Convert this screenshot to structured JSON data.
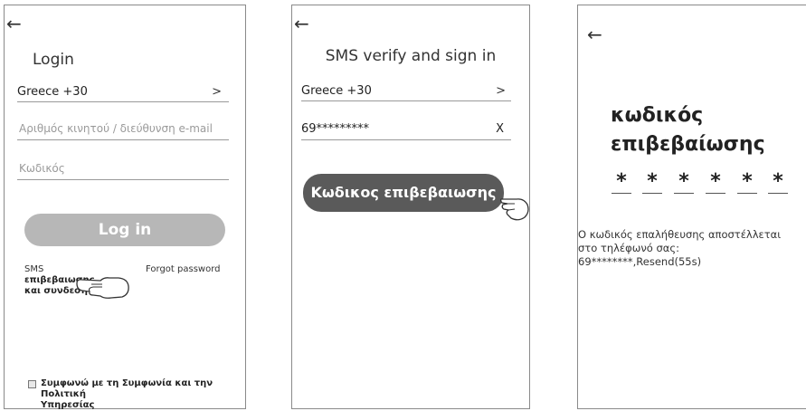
{
  "screen1": {
    "back": "←",
    "title": "Login",
    "country": "Greece +30",
    "chevron": ">",
    "phone_placeholder": "Αριθμός κινητού / διεύθυνση e-mail",
    "password_placeholder": "Κωδικός",
    "login_button": "Log in",
    "sms_line1": "SMS",
    "sms_line2": "επιβεβαιωσης",
    "sms_line3": "και συνδεση",
    "forgot": "Forgot password",
    "agree_line1": "Συμφωνώ με τη Συμφωνία και την Πολιτική",
    "agree_line2": "Υπηρεσίας"
  },
  "screen2": {
    "back": "←",
    "title": "SMS verify and sign in",
    "country": "Greece +30",
    "chevron": ">",
    "phone": "69*********",
    "clear": "X",
    "code_button": "Κωδικος επιβεβαιωσης"
  },
  "screen3": {
    "back": "←",
    "title_line1": "κωδικός",
    "title_line2": "επιβεβαίωσης",
    "digits": [
      "*",
      "*",
      "*",
      "*",
      "*",
      "*"
    ],
    "info_line1": "Ο κωδικός επαλήθευσης αποστέλλεται",
    "info_line2": "στο τηλέφωνό σας:",
    "info_line3": "69********,Resend(55s)"
  },
  "icons": {
    "pointer": "pointing-hand-icon"
  }
}
